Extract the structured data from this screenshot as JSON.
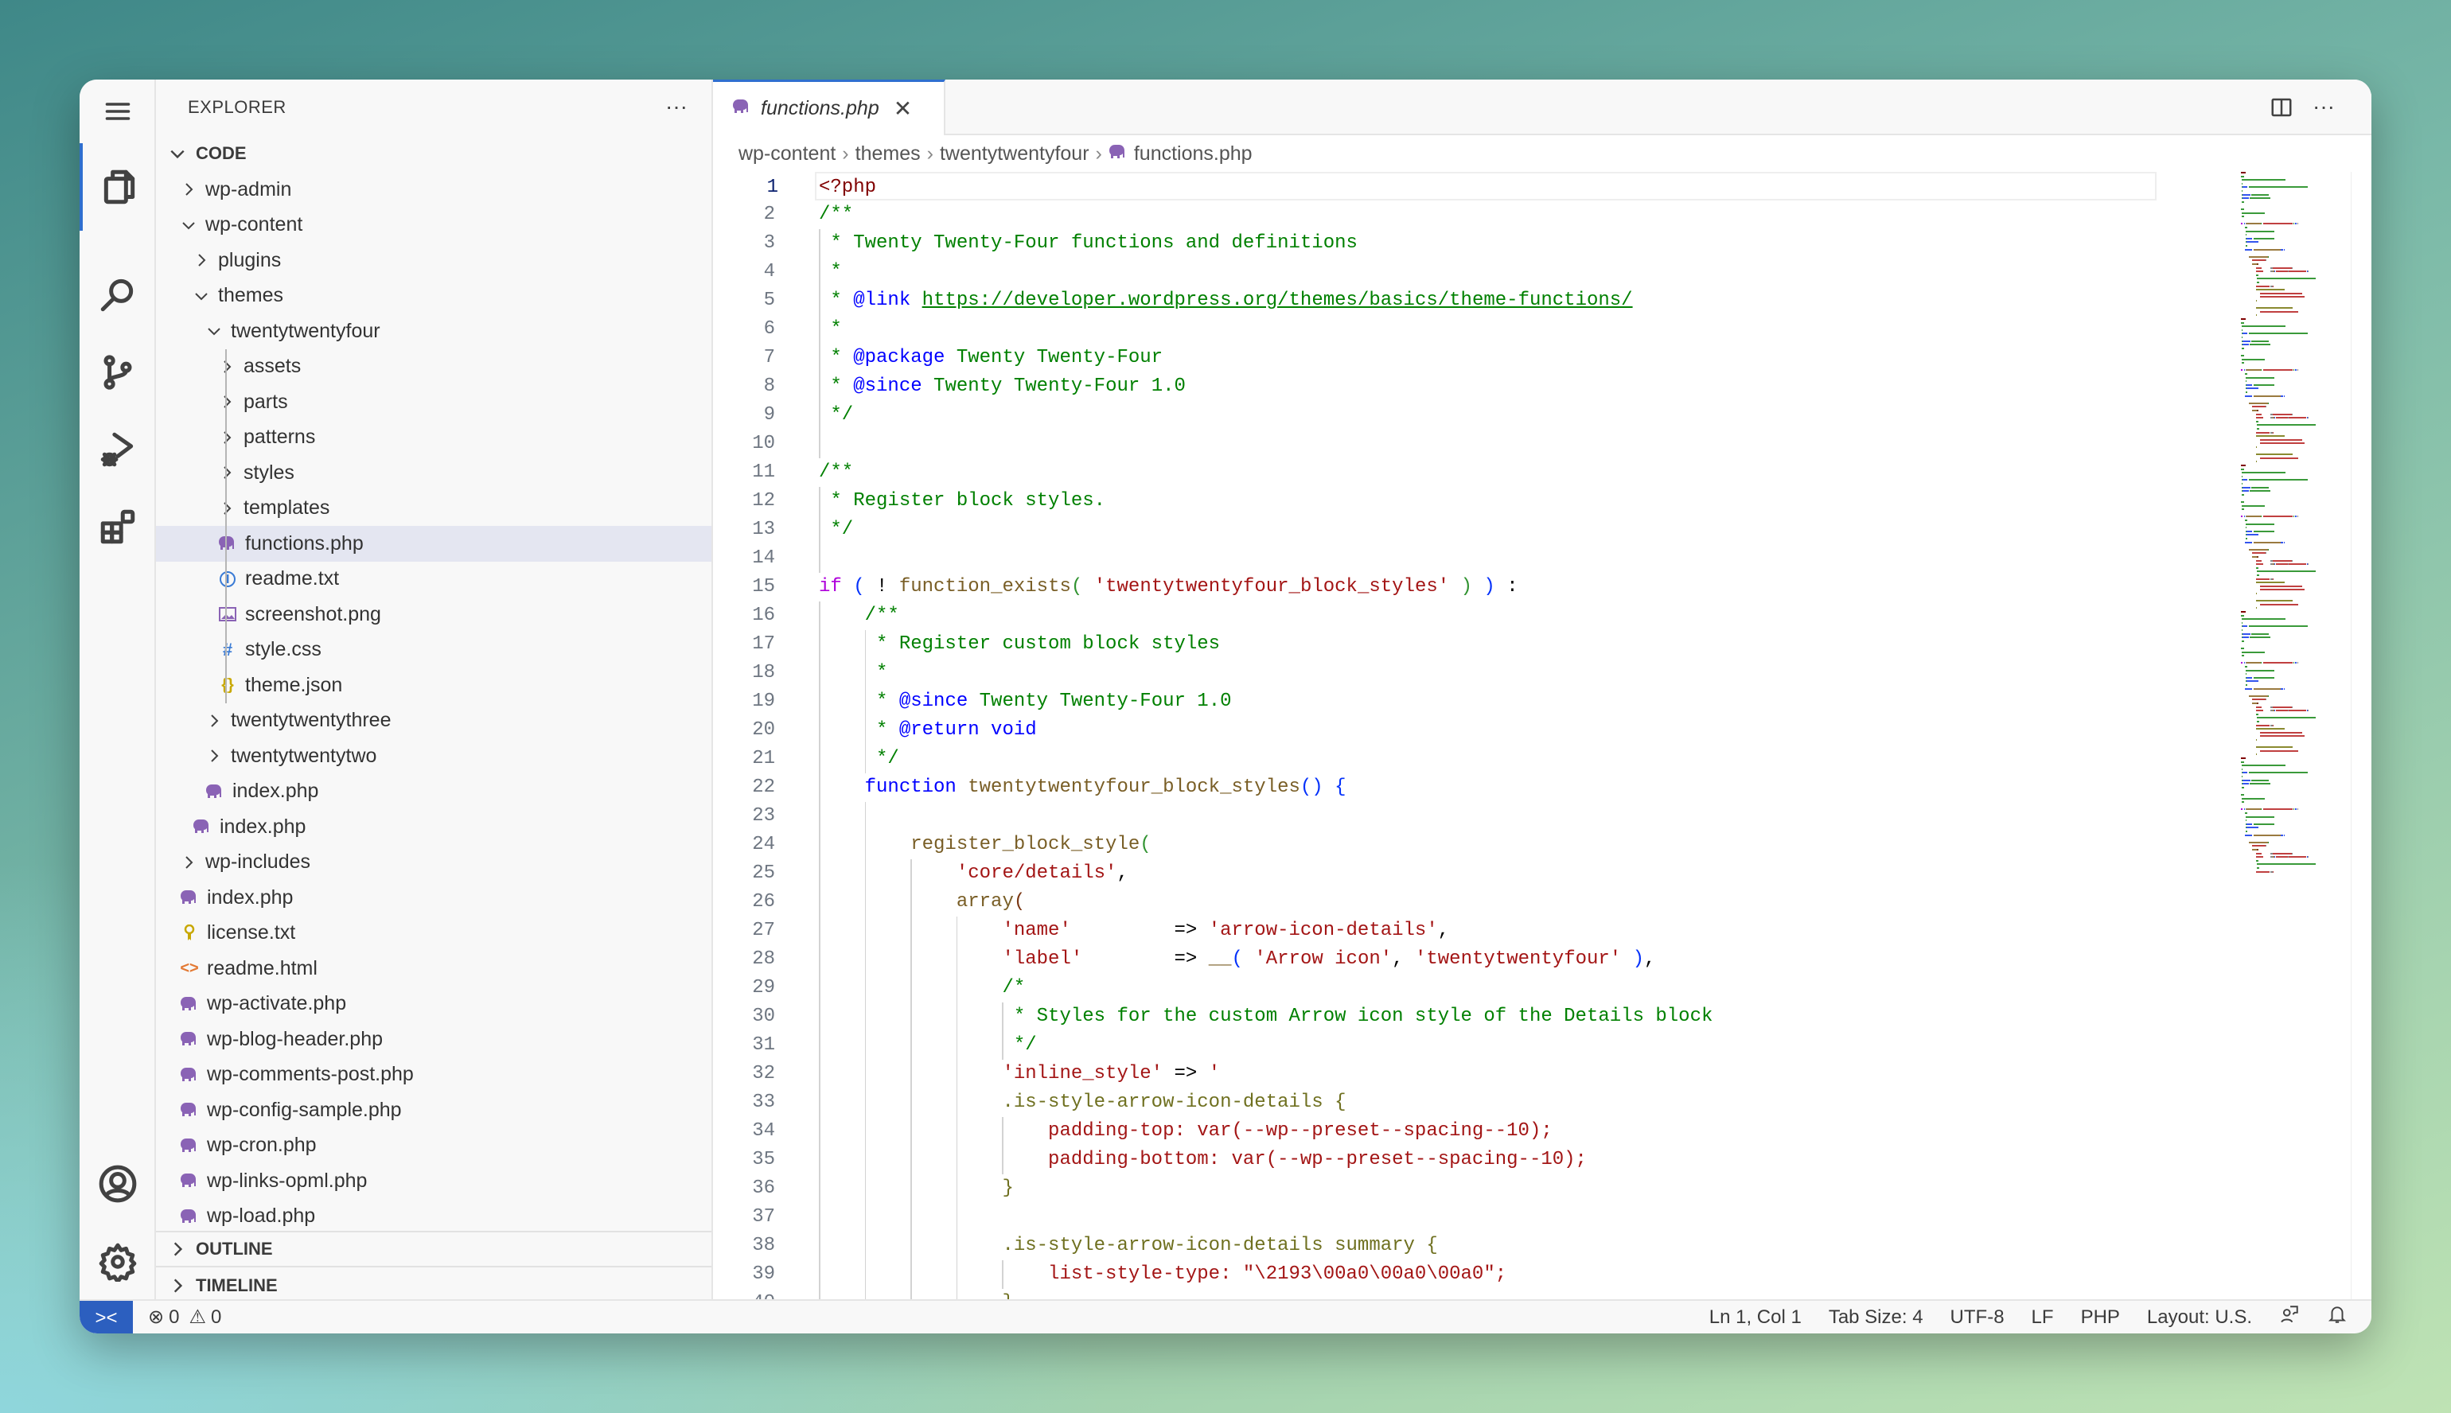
{
  "colors": {
    "accent": "#2f6fcf",
    "remote": "#2c5fbf",
    "php_icon": "#8a63b5",
    "selection": "#e4e6f1"
  },
  "activity_bar": {
    "items": [
      "menu-icon",
      "explorer-icon",
      "search-icon",
      "source-control-icon",
      "run-debug-icon",
      "extensions-icon",
      "accounts-icon",
      "settings-icon"
    ],
    "active": "explorer-icon"
  },
  "sidebar": {
    "title": "EXPLORER",
    "more": "···",
    "root": "CODE",
    "items": [
      {
        "label": "wp-admin",
        "depth": 1,
        "kind": "folder"
      },
      {
        "label": "wp-content",
        "depth": 1,
        "kind": "folder-open"
      },
      {
        "label": "plugins",
        "depth": 2,
        "kind": "folder"
      },
      {
        "label": "themes",
        "depth": 2,
        "kind": "folder-open"
      },
      {
        "label": "twentytwentyfour",
        "depth": 3,
        "kind": "folder-open"
      },
      {
        "label": "assets",
        "depth": 4,
        "kind": "folder"
      },
      {
        "label": "parts",
        "depth": 4,
        "kind": "folder"
      },
      {
        "label": "patterns",
        "depth": 4,
        "kind": "folder"
      },
      {
        "label": "styles",
        "depth": 4,
        "kind": "folder"
      },
      {
        "label": "templates",
        "depth": 4,
        "kind": "folder"
      },
      {
        "label": "functions.php",
        "depth": 4,
        "kind": "file",
        "icon": "php",
        "selected": true
      },
      {
        "label": "readme.txt",
        "depth": 4,
        "kind": "file",
        "icon": "info"
      },
      {
        "label": "screenshot.png",
        "depth": 4,
        "kind": "file",
        "icon": "image"
      },
      {
        "label": "style.css",
        "depth": 4,
        "kind": "file",
        "icon": "css"
      },
      {
        "label": "theme.json",
        "depth": 4,
        "kind": "file",
        "icon": "json"
      },
      {
        "label": "twentytwentythree",
        "depth": 3,
        "kind": "folder"
      },
      {
        "label": "twentytwentytwo",
        "depth": 3,
        "kind": "folder"
      },
      {
        "label": "index.php",
        "depth": 3,
        "kind": "file",
        "icon": "php"
      },
      {
        "label": "index.php",
        "depth": 2,
        "kind": "file",
        "icon": "php"
      },
      {
        "label": "wp-includes",
        "depth": 1,
        "kind": "folder"
      },
      {
        "label": "index.php",
        "depth": 1,
        "kind": "file",
        "icon": "php"
      },
      {
        "label": "license.txt",
        "depth": 1,
        "kind": "file",
        "icon": "license"
      },
      {
        "label": "readme.html",
        "depth": 1,
        "kind": "file",
        "icon": "html"
      },
      {
        "label": "wp-activate.php",
        "depth": 1,
        "kind": "file",
        "icon": "php"
      },
      {
        "label": "wp-blog-header.php",
        "depth": 1,
        "kind": "file",
        "icon": "php"
      },
      {
        "label": "wp-comments-post.php",
        "depth": 1,
        "kind": "file",
        "icon": "php"
      },
      {
        "label": "wp-config-sample.php",
        "depth": 1,
        "kind": "file",
        "icon": "php"
      },
      {
        "label": "wp-cron.php",
        "depth": 1,
        "kind": "file",
        "icon": "php"
      },
      {
        "label": "wp-links-opml.php",
        "depth": 1,
        "kind": "file",
        "icon": "php"
      },
      {
        "label": "wp-load.php",
        "depth": 1,
        "kind": "file",
        "icon": "php"
      }
    ],
    "outline": "OUTLINE",
    "timeline": "TIMELINE"
  },
  "editor": {
    "tab": {
      "label": "functions.php",
      "close": "✕"
    },
    "actions": {
      "split": "split-editor-icon",
      "more": "···"
    },
    "breadcrumbs": [
      "wp-content",
      "themes",
      "twentytwentyfour",
      "functions.php"
    ],
    "current_line": 1,
    "lines": [
      [
        [
          "tag",
          "<?php"
        ]
      ],
      [
        [
          "cm",
          "/**"
        ]
      ],
      [
        [
          "cm",
          " * Twenty Twenty-Four functions and definitions"
        ]
      ],
      [
        [
          "cm",
          " *"
        ]
      ],
      [
        [
          "cm",
          " * "
        ],
        [
          "dt",
          "@link"
        ],
        [
          "cm",
          " "
        ],
        [
          "url",
          "https://developer.wordpress.org/themes/basics/theme-functions/"
        ]
      ],
      [
        [
          "cm",
          " *"
        ]
      ],
      [
        [
          "cm",
          " * "
        ],
        [
          "dt",
          "@package"
        ],
        [
          "cm",
          " Twenty Twenty-Four"
        ]
      ],
      [
        [
          "cm",
          " * "
        ],
        [
          "dt",
          "@since"
        ],
        [
          "cm",
          " Twenty Twenty-Four 1.0"
        ]
      ],
      [
        [
          "cm",
          " */"
        ]
      ],
      [],
      [
        [
          "cm",
          "/**"
        ]
      ],
      [
        [
          "cm",
          " * Register block styles."
        ]
      ],
      [
        [
          "cm",
          " */"
        ]
      ],
      [],
      [
        [
          "kw",
          "if"
        ],
        [
          "p",
          " "
        ],
        [
          "b1",
          "("
        ],
        [
          "p",
          " ! "
        ],
        [
          "fn",
          "function_exists"
        ],
        [
          "b2",
          "("
        ],
        [
          "p",
          " "
        ],
        [
          "s",
          "'twentytwentyfour_block_styles'"
        ],
        [
          "p",
          " "
        ],
        [
          "b2",
          ")"
        ],
        [
          "p",
          " "
        ],
        [
          "b1",
          ")"
        ],
        [
          "p",
          " :"
        ]
      ],
      [
        [
          "p",
          "\t"
        ],
        [
          "cm",
          "/**"
        ]
      ],
      [
        [
          "p",
          "\t"
        ],
        [
          "cm",
          " * Register custom block styles"
        ]
      ],
      [
        [
          "p",
          "\t"
        ],
        [
          "cm",
          " *"
        ]
      ],
      [
        [
          "p",
          "\t"
        ],
        [
          "cm",
          " * "
        ],
        [
          "dt",
          "@since"
        ],
        [
          "cm",
          " Twenty Twenty-Four 1.0"
        ]
      ],
      [
        [
          "p",
          "\t"
        ],
        [
          "cm",
          " * "
        ],
        [
          "dt",
          "@return void"
        ]
      ],
      [
        [
          "p",
          "\t"
        ],
        [
          "cm",
          " */"
        ]
      ],
      [
        [
          "p",
          "\t"
        ],
        [
          "fk",
          "function"
        ],
        [
          "p",
          " "
        ],
        [
          "fn",
          "twentytwentyfour_block_styles"
        ],
        [
          "b1",
          "()"
        ],
        [
          "p",
          " "
        ],
        [
          "b1",
          "{"
        ]
      ],
      [],
      [
        [
          "p",
          "\t\t"
        ],
        [
          "fn",
          "register_block_style"
        ],
        [
          "b2",
          "("
        ]
      ],
      [
        [
          "p",
          "\t\t\t"
        ],
        [
          "s",
          "'core/details'"
        ],
        [
          "p",
          ","
        ]
      ],
      [
        [
          "p",
          "\t\t\t"
        ],
        [
          "fn",
          "array"
        ],
        [
          "b3",
          "("
        ]
      ],
      [
        [
          "p",
          "\t\t\t\t"
        ],
        [
          "s",
          "'name'"
        ],
        [
          "p",
          "         => "
        ],
        [
          "s",
          "'arrow-icon-details'"
        ],
        [
          "p",
          ","
        ]
      ],
      [
        [
          "p",
          "\t\t\t\t"
        ],
        [
          "s",
          "'label'"
        ],
        [
          "p",
          "        => "
        ],
        [
          "fn",
          "__"
        ],
        [
          "b1",
          "("
        ],
        [
          "p",
          " "
        ],
        [
          "s",
          "'Arrow icon'"
        ],
        [
          "p",
          ", "
        ],
        [
          "s",
          "'twentytwentyfour'"
        ],
        [
          "p",
          " "
        ],
        [
          "b1",
          ")"
        ],
        [
          "p",
          ","
        ]
      ],
      [
        [
          "p",
          "\t\t\t\t"
        ],
        [
          "cm",
          "/*"
        ]
      ],
      [
        [
          "p",
          "\t\t\t\t"
        ],
        [
          "cm",
          " * Styles for the custom Arrow icon style of the Details block"
        ]
      ],
      [
        [
          "p",
          "\t\t\t\t"
        ],
        [
          "cm",
          " */"
        ]
      ],
      [
        [
          "p",
          "\t\t\t\t"
        ],
        [
          "s",
          "'inline_style'"
        ],
        [
          "p",
          " => "
        ],
        [
          "s",
          "'"
        ]
      ],
      [
        [
          "p",
          "\t\t\t\t"
        ],
        [
          "sel",
          ".is-style-arrow-icon-details {"
        ]
      ],
      [
        [
          "p",
          "\t\t\t\t\t"
        ],
        [
          "prop",
          "padding-top: var(--wp--preset--spacing--10);"
        ]
      ],
      [
        [
          "p",
          "\t\t\t\t\t"
        ],
        [
          "prop",
          "padding-bottom: var(--wp--preset--spacing--10);"
        ]
      ],
      [
        [
          "p",
          "\t\t\t\t"
        ],
        [
          "sel",
          "}"
        ]
      ],
      [],
      [
        [
          "p",
          "\t\t\t\t"
        ],
        [
          "sel",
          ".is-style-arrow-icon-details summary {"
        ]
      ],
      [
        [
          "p",
          "\t\t\t\t\t"
        ],
        [
          "prop",
          "list-style-type: \"\\2193\\00a0\\00a0\\00a0\";"
        ]
      ],
      [
        [
          "p",
          "\t\t\t\t"
        ],
        [
          "sel",
          "}"
        ]
      ]
    ]
  },
  "status": {
    "errors": "0",
    "warnings": "0",
    "position": "Ln 1, Col 1",
    "tab_size": "Tab Size: 4",
    "encoding": "UTF-8",
    "eol": "LF",
    "language": "PHP",
    "layout": "Layout: U.S."
  }
}
